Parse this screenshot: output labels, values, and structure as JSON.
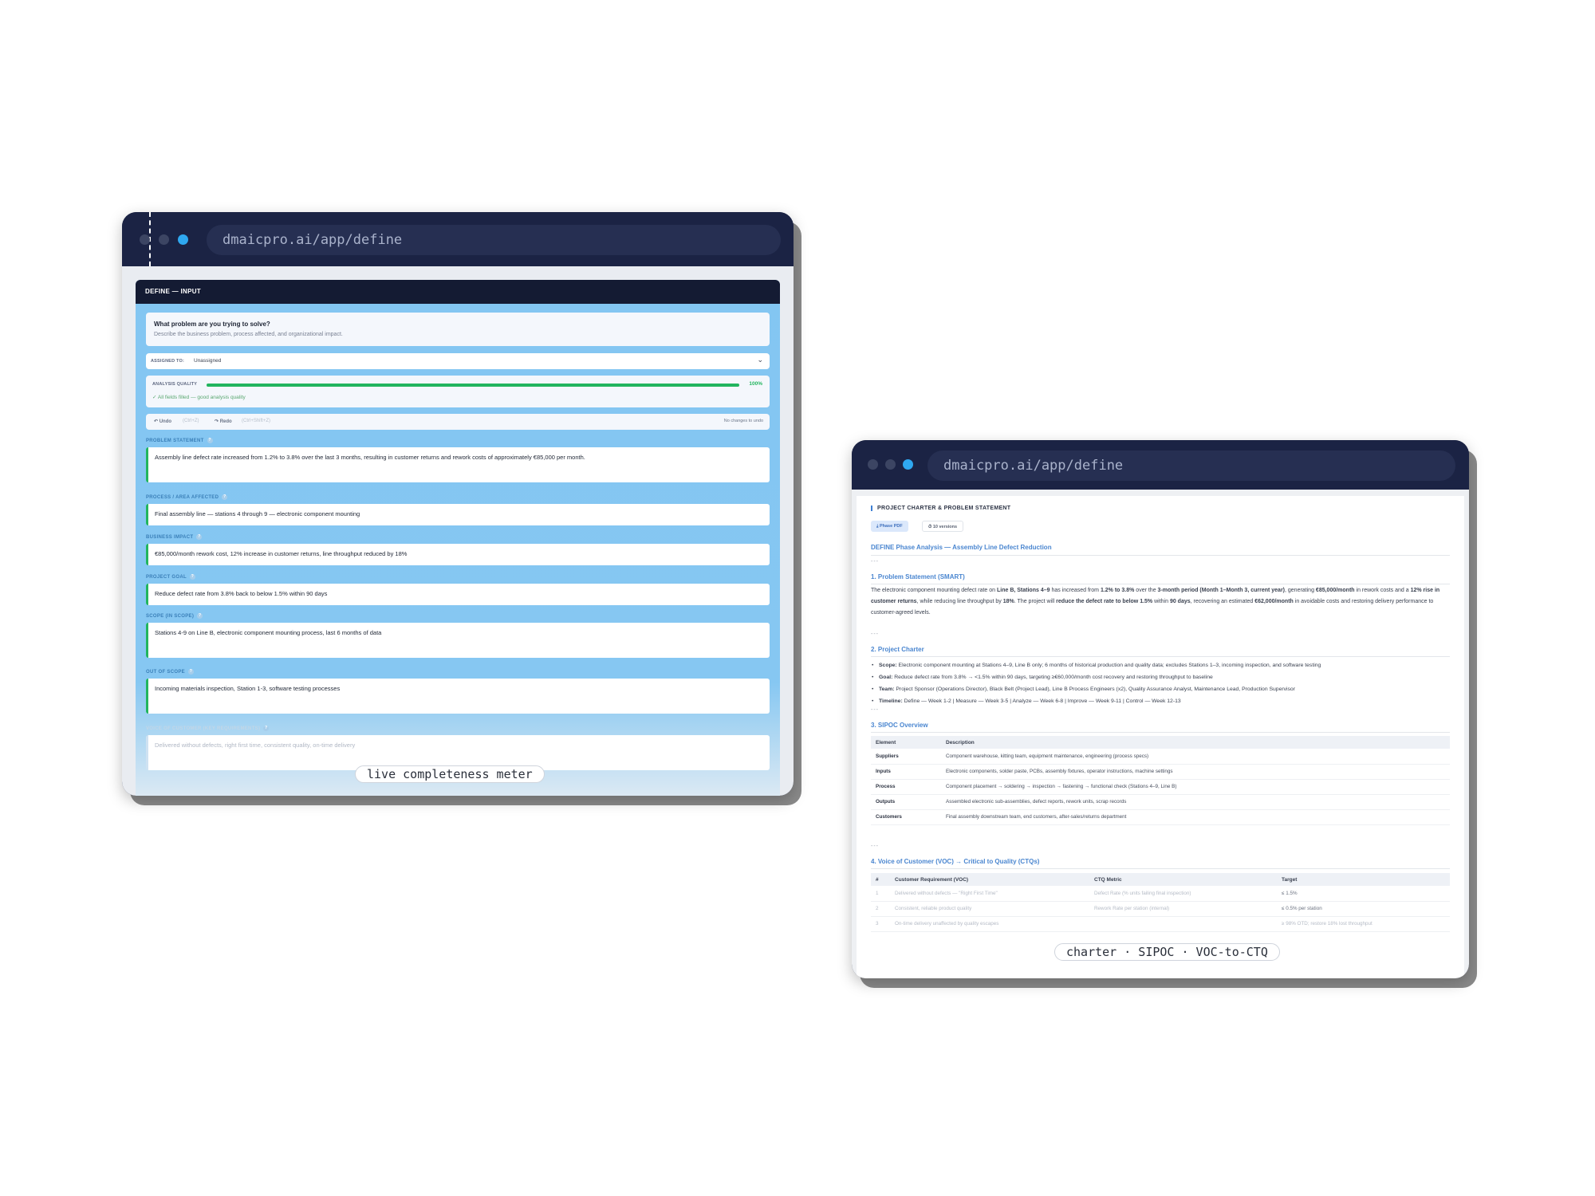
{
  "left_window": {
    "url": "dmaicpro.ai/app/define",
    "panel_title": "DEFINE — INPUT",
    "question": {
      "title": "What problem are you trying to solve?",
      "subtitle": "Describe the business problem, process affected, and organizational impact."
    },
    "assigned": {
      "label": "ASSIGNED TO:",
      "value": "Unassigned"
    },
    "quality": {
      "label": "ANALYSIS QUALITY",
      "percent_label": "100%",
      "percent": 100,
      "status": "✓ All fields filled — good analysis quality"
    },
    "toolbar": {
      "undo_label": "↶ Undo",
      "undo_hint": "(Ctrl+Z)",
      "redo_label": "↷ Redo",
      "redo_hint": "(Ctrl+Shift+Z)",
      "status": "No changes to undo"
    },
    "fields": [
      {
        "label": "PROBLEM STATEMENT",
        "value": "Assembly line defect rate increased from 1.2% to 3.8% over the last 3 months, resulting in customer returns and rework costs of approximately €85,000 per month."
      },
      {
        "label": "PROCESS / AREA AFFECTED",
        "value": "Final assembly line — stations 4 through 9 — electronic component mounting"
      },
      {
        "label": "BUSINESS IMPACT",
        "value": "€85,000/month rework cost, 12% increase in customer returns, line throughput reduced by 18%"
      },
      {
        "label": "PROJECT GOAL",
        "value": "Reduce defect rate from 3.8% back to below 1.5% within 90 days"
      },
      {
        "label": "SCOPE (IN SCOPE)",
        "value": "Stations 4-9 on Line B, electronic component mounting process, last 6 months of data"
      },
      {
        "label": "OUT OF SCOPE",
        "value": "Incoming materials inspection, Station 1-3, software testing processes"
      },
      {
        "label": "VOICE OF CUSTOMER (KEY REQUIREMENTS)",
        "value": "Delivered without defects, right first time, consistent quality, on-time delivery"
      }
    ],
    "caption": "live completeness meter"
  },
  "right_window": {
    "url": "dmaicpro.ai/app/define",
    "doc_title": "PROJECT CHARTER & PROBLEM STATEMENT",
    "buttons": {
      "pdf": "⤓ Phase PDF",
      "versions": "⏱ 10 versions"
    },
    "heading": "DEFINE Phase Analysis — Assembly Line Defect Reduction",
    "separator": "---",
    "sections": {
      "problem": {
        "title": "1. Problem Statement (SMART)",
        "t1": "The electronic component mounting defect rate on ",
        "b1": "Line B, Stations 4–9",
        "t2": " has increased from ",
        "b2": "1.2% to 3.8%",
        "t3": " over the ",
        "b3": "3-month period (Month 1–Month 3, current year)",
        "t4": ", generating ",
        "b4": "€85,000/month",
        "t5": " in rework costs and a ",
        "b5": "12% rise in customer returns",
        "t6": ", while reducing line throughput by ",
        "b6": "18%",
        "t7": ". The project will ",
        "b7": "reduce the defect rate to below 1.5%",
        "t8": " within ",
        "b8": "90 days",
        "t9": ", recovering an estimated ",
        "b9": "€62,000/month",
        "t10": " in avoidable costs and restoring delivery performance to customer-agreed levels."
      },
      "charter": {
        "title": "2. Project Charter",
        "items": [
          {
            "k": "Scope:",
            "v": " Electronic component mounting at Stations 4–9, Line B only; 6 months of historical production and quality data; excludes Stations 1–3, incoming inspection, and software testing"
          },
          {
            "k": "Goal:",
            "v": " Reduce defect rate from 3.8% → <1.5% within 90 days, targeting ≥€60,000/month cost recovery and restoring throughput to baseline"
          },
          {
            "k": "Team:",
            "v": " Project Sponsor (Operations Director), Black Belt (Project Lead), Line B Process Engineers (x2), Quality Assurance Analyst, Maintenance Lead, Production Supervisor"
          },
          {
            "k": "Timeline:",
            "v": " Define — Week 1-2 | Measure — Week 3-5 | Analyze — Week 6-8 | Improve — Week 9-11 | Control — Week 12-13"
          }
        ]
      },
      "sipoc": {
        "title": "3. SIPOC Overview",
        "headers": [
          "Element",
          "Description"
        ],
        "rows": [
          [
            "Suppliers",
            "Component warehouse, kitting team, equipment maintenance, engineering (process specs)"
          ],
          [
            "Inputs",
            "Electronic components, solder paste, PCBs, assembly fixtures, operator instructions, machine settings"
          ],
          [
            "Process",
            "Component placement → soldering → inspection → fastening → functional check (Stations 4–9, Line B)"
          ],
          [
            "Outputs",
            "Assembled electronic sub-assemblies, defect reports, rework units, scrap records"
          ],
          [
            "Customers",
            "Final assembly downstream team, end customers, after-sales/returns department"
          ]
        ]
      },
      "voc": {
        "title": "4. Voice of Customer (VOC) → Critical to Quality (CTQs)",
        "headers": [
          "#",
          "Customer Requirement (VOC)",
          "CTQ Metric",
          "Target"
        ],
        "rows": [
          [
            "1",
            "Delivered without defects — \"Right First Time\"",
            "Defect Rate (% units failing final inspection)",
            "≤ 1.5%"
          ],
          [
            "2",
            "Consistent, reliable product quality",
            "Rework Rate per station (internal)",
            "≤ 0.5% per station"
          ],
          [
            "3",
            "On-time delivery unaffected by quality escapes",
            "",
            "≥ 98% OTD; restore 18% lost throughput"
          ]
        ]
      }
    },
    "caption": "charter · SIPOC · VOC-to-CTQ"
  }
}
